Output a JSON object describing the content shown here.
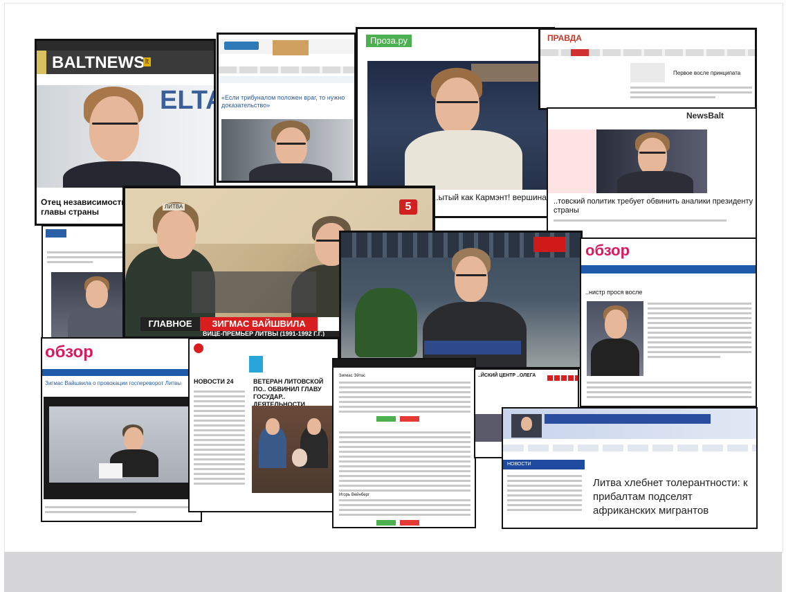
{
  "slide": {
    "title": "",
    "colors": {
      "background": "#ffffff",
      "footer_band": "#d6d6d8",
      "frame_border": "#111111"
    }
  },
  "clips": {
    "baltnews": {
      "logo": "BALTNEWS",
      "logo_badge": "lt",
      "watermark": "ELTA",
      "headline": "Отец независимости Литвы должна поки главы страны"
    },
    "rubaltic": {
      "headline": "«Если трибуналом положен враг, то нужно доказательство»"
    },
    "proza": {
      "logo": "Проза.ру",
      "caption": "..ытый как Кармэнт! вершина"
    },
    "kp": {
      "logo": "ПРАВДА",
      "headline": "Первое восле принципата"
    },
    "newsbalt": {
      "logo": "NewsBalt",
      "headline": "..товский политик требует обвинить аналики президенту страны"
    },
    "channel5": {
      "badge": "ЛИТВА",
      "channel_num": "5",
      "ticker_left": "ГЛАВНОЕ",
      "ticker_name": "ЗИГМАС ВАЙШВИЛА",
      "ticker_sub": "ВИЦЕ-ПРЕМЬЕР ЛИТВЫ (1991-1992 Г.Г.)"
    },
    "obzor_right": {
      "logo": "обзор",
      "headline": "..нистр прося восле"
    },
    "obzor_left": {
      "logo": "обзор",
      "headline": "Зигмас Вайшвила о провокации госпереворот Литвы"
    },
    "kp2": {
      "section": "НОВОСТИ 24",
      "headline": "ВЕТЕРАН ЛИТОВСКОЙ ПО.. ОБВИНИЛ ГЛАВУ ГОСУДАР.. ДЕЯТЕЛЬНОСТИ"
    },
    "article_panel": {
      "author_a": "Зигмас Эйтас",
      "author_b": "Игорь Вейнберг"
    },
    "baltic_center": {
      "headline": "..ЙСКИЙ ЦЕНТР ..ОЛЕГА"
    },
    "partner": {
      "headline": "Литва хлебнет толерантности: к прибалтам подселят африканских мигрантов",
      "section": "НОВОСТИ"
    }
  }
}
